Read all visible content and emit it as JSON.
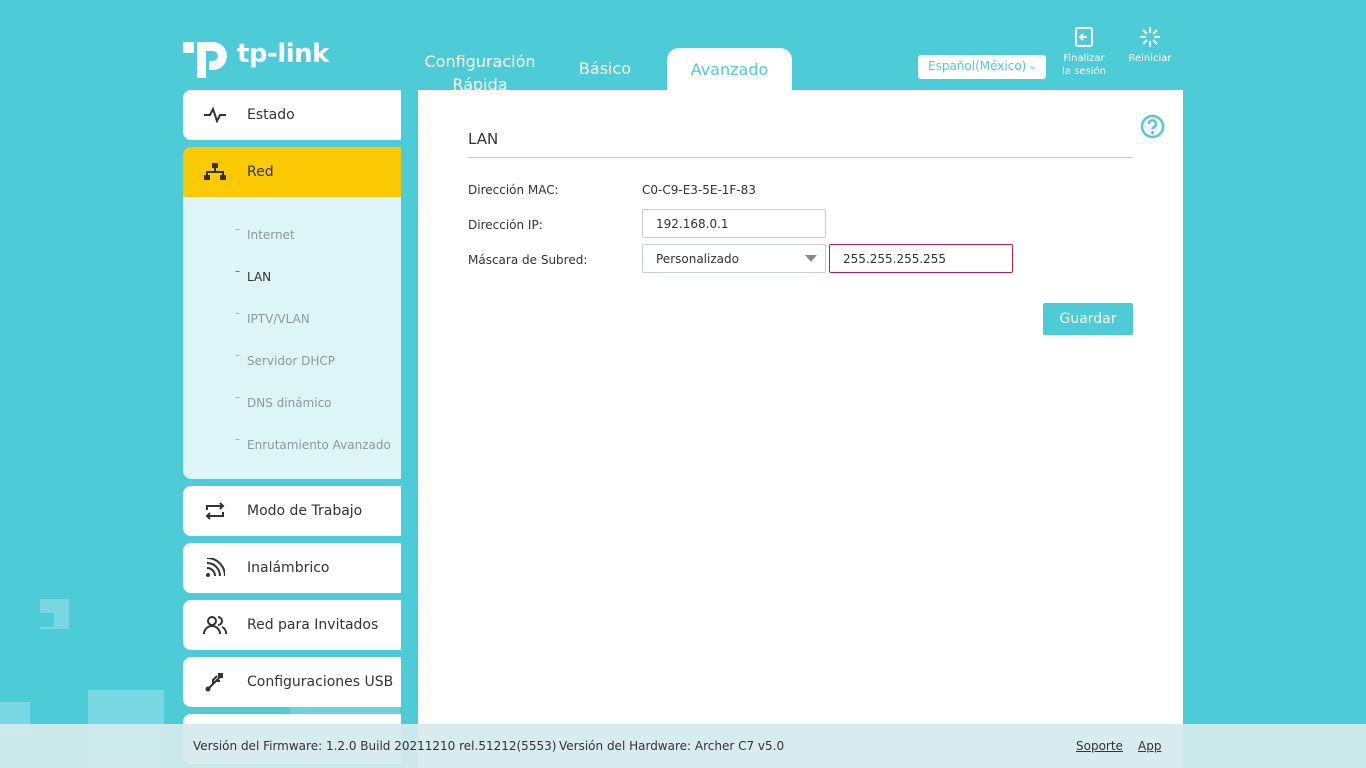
{
  "brand": {
    "logo_text": "tp-link",
    "accent": "#4dcbd6",
    "highlight": "#fcca05"
  },
  "top_tabs": [
    {
      "label": "Configuración Rápida"
    },
    {
      "label": "Básico"
    },
    {
      "label": "Avanzado",
      "active": true
    }
  ],
  "language": {
    "selected": "Español(México)"
  },
  "top_actions": {
    "logout_label": "Finalizar la sesión",
    "reboot_label": "Reiniciar"
  },
  "sidebar": {
    "items": [
      {
        "label": "Estado",
        "icon": "pulse-icon"
      },
      {
        "label": "Red",
        "icon": "network-icon",
        "active": true
      },
      {
        "label": "Modo de Trabajo",
        "icon": "switch-mode-icon"
      },
      {
        "label": "Inalámbrico",
        "icon": "wifi-icon"
      },
      {
        "label": "Red para Invitados",
        "icon": "guests-icon"
      },
      {
        "label": "Configuraciones USB",
        "icon": "usb-icon"
      }
    ],
    "sub_items": [
      {
        "label": "Internet"
      },
      {
        "label": "LAN",
        "selected": true
      },
      {
        "label": "IPTV/VLAN"
      },
      {
        "label": "Servidor DHCP"
      },
      {
        "label": "DNS dinámico"
      },
      {
        "label": "Enrutamiento Avanzado"
      }
    ]
  },
  "main": {
    "title": "LAN",
    "mac_label": "Dirección MAC:",
    "mac_value": "C0-C9-E3-5E-1F-83",
    "ip_label": "Dirección IP:",
    "ip_value": "192.168.0.1",
    "mask_label": "Máscara de Subred:",
    "mask_mode": "Personalizado",
    "mask_value": "255.255.255.255",
    "save_label": "Guardar"
  },
  "footer": {
    "firmware": "Versión del Firmware: 1.2.0 Build 20211210 rel.51212(5553)",
    "hardware": "Versión del Hardware: Archer C7 v5.0",
    "support": "Soporte",
    "app": "App"
  }
}
